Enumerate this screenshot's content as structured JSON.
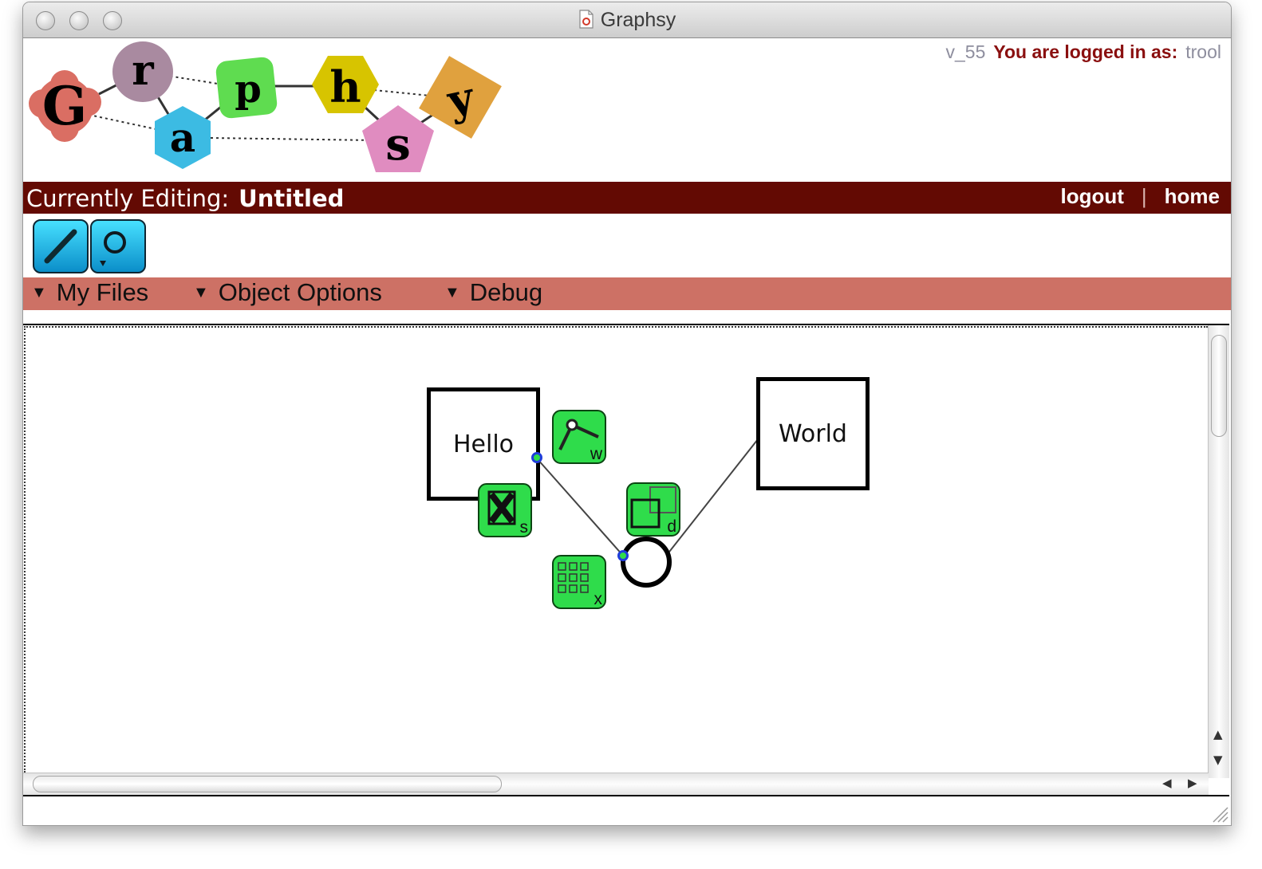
{
  "window": {
    "title": "Graphsy"
  },
  "header": {
    "logo_letters": [
      "G",
      "r",
      "a",
      "p",
      "h",
      "s",
      "y"
    ],
    "version": "v_55",
    "logged_in_label": "You are logged in as:",
    "username": "trool"
  },
  "editbar": {
    "label": "Currently Editing:",
    "document_name": "Untitled",
    "logout": "logout",
    "separator": "|",
    "home": "home"
  },
  "tools": {
    "items": [
      {
        "name": "edge-tool",
        "icon": "line-icon"
      },
      {
        "name": "node-tool",
        "icon": "circle-icon"
      }
    ]
  },
  "menus": [
    {
      "label": "My Files"
    },
    {
      "label": "Object Options"
    },
    {
      "label": "Debug"
    }
  ],
  "canvas": {
    "nodes": [
      {
        "label": "Hello",
        "shape": "square"
      },
      {
        "label": "World",
        "shape": "square"
      },
      {
        "label": "",
        "shape": "circle"
      }
    ],
    "context_buttons": [
      {
        "key": "w",
        "icon": "edge-draw-icon"
      },
      {
        "key": "s",
        "icon": "delete-x-icon"
      },
      {
        "key": "d",
        "icon": "duplicate-icon"
      },
      {
        "key": "x",
        "icon": "grid-icon"
      }
    ]
  },
  "colors": {
    "edit_bar": "#630a03",
    "menu_bar": "#cd7165",
    "logged_in_text": "#8a0f0f",
    "context_button": "#2fdc4b",
    "tool_button": "#1bb6e8",
    "handle_border": "#1f3cdb"
  }
}
